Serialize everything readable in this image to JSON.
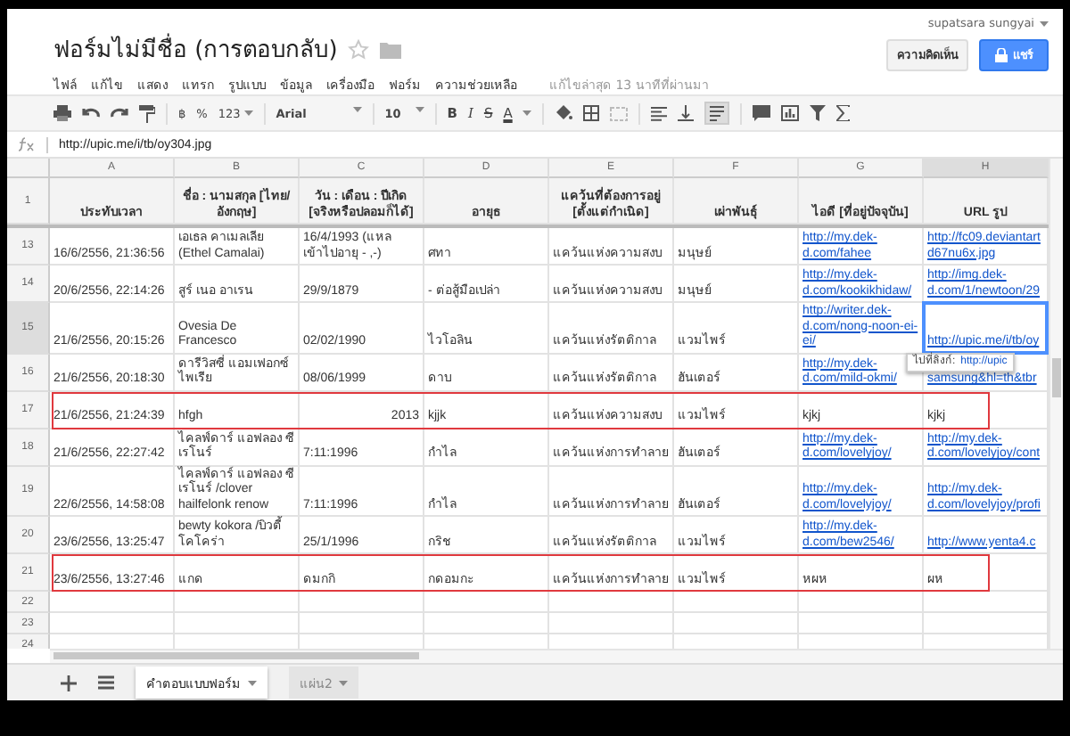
{
  "document": {
    "title": "ฟอร์มไม่มีชื่อ (การตอบกลับ)",
    "starred": false,
    "user": "supatsara sungyai",
    "comment_button": "ความคิดเห็น",
    "share_button": "แชร์",
    "last_edit": "แก้ไขล่าสุด 13 นาทีที่ผ่านมา"
  },
  "menu": [
    "ไฟล์",
    "แก้ไข",
    "แสดง",
    "แทรก",
    "รูปแบบ",
    "ข้อมูล",
    "เครื่องมือ",
    "ฟอร์ม",
    "ความช่วยเหลือ"
  ],
  "toolbar": {
    "currency": "฿",
    "percent": "%",
    "number_format": "123",
    "font": "Arial",
    "font_size": "10",
    "bold": "B",
    "italic": "I",
    "strikethrough": "S",
    "text_color": "A"
  },
  "formula_bar": {
    "value": "http://upic.me/i/tb/oy304.jpg"
  },
  "columns": [
    {
      "letter": "A",
      "selected": false
    },
    {
      "letter": "B",
      "selected": false
    },
    {
      "letter": "C",
      "selected": false
    },
    {
      "letter": "D",
      "selected": false
    },
    {
      "letter": "E",
      "selected": false
    },
    {
      "letter": "F",
      "selected": false
    },
    {
      "letter": "G",
      "selected": false
    },
    {
      "letter": "H",
      "selected": true
    }
  ],
  "header_row": {
    "number": "1",
    "cells": [
      "ประทับเวลา",
      "ชื่อ : นามสกุล [ไทย/อังกฤษ]",
      "วัน : เดือน : ปีเกิด [จริงหรือปลอมก็ได้]",
      "อายุธ",
      "แคว้นที่ต้องการอยู่ [ตั้งแต่กำเนิด]",
      "เผ่าพันธุ์",
      "ไอดี [ที่อยู่ปัจจุบัน]",
      "URL รูป"
    ]
  },
  "rows": [
    {
      "number": "13",
      "selected": false,
      "highlighted": false,
      "cells": [
        {
          "text": "16/6/2556, 21:36:56",
          "kind": "text"
        },
        {
          "text": "เอเธล คาเมลเลีย (Ethel Camalai)",
          "kind": "text"
        },
        {
          "text": "16/4/1993 (แหล เข้าไปอายุ - ,-)",
          "kind": "text"
        },
        {
          "text": "ศทา",
          "kind": "text"
        },
        {
          "text": "แคว้นแห่งความสงบ",
          "kind": "text"
        },
        {
          "text": "มนุษย์",
          "kind": "text"
        },
        {
          "text": "http://my.dek-d.com/fahee",
          "kind": "link"
        },
        {
          "text": "http://fc09.deviantart d67nu6x.jpg",
          "kind": "link"
        }
      ]
    },
    {
      "number": "14",
      "selected": false,
      "highlighted": false,
      "cells": [
        {
          "text": "20/6/2556, 22:14:26",
          "kind": "text"
        },
        {
          "text": "สูร์ เนอ อาเรน",
          "kind": "text"
        },
        {
          "text": "29/9/1879",
          "kind": "text"
        },
        {
          "text": "- ต่อสู้มือเปล่า",
          "kind": "text"
        },
        {
          "text": "แคว้นแห่งความสงบ",
          "kind": "text"
        },
        {
          "text": "มนุษย์",
          "kind": "text"
        },
        {
          "text": "http://my.dek-d.com/kookikhidaw/",
          "kind": "link"
        },
        {
          "text": "http://img.dek-d.com/1/newtoon/29",
          "kind": "link"
        }
      ]
    },
    {
      "number": "15",
      "selected": true,
      "highlighted": false,
      "cells": [
        {
          "text": "21/6/2556, 20:15:26",
          "kind": "text"
        },
        {
          "text": "Ovesia De Francesco",
          "kind": "text"
        },
        {
          "text": "02/02/1990",
          "kind": "text"
        },
        {
          "text": "ไวโอลิน",
          "kind": "text"
        },
        {
          "text": "แคว้นแห่งรัตติกาล",
          "kind": "text"
        },
        {
          "text": "แวมไพร์",
          "kind": "text"
        },
        {
          "text": "http://writer.dek-d.com/nong-noon-ei-ei/",
          "kind": "link"
        },
        {
          "text": "http://upic.me/i/tb/oy",
          "kind": "link"
        }
      ]
    },
    {
      "number": "16",
      "selected": false,
      "highlighted": false,
      "cells": [
        {
          "text": "21/6/2556, 20:18:30",
          "kind": "text"
        },
        {
          "text": "ดารีวิสซี่ แอมเฟอกซ์ ไพเรีย",
          "kind": "text"
        },
        {
          "text": "08/06/1999",
          "kind": "text"
        },
        {
          "text": "ดาบ",
          "kind": "text"
        },
        {
          "text": "แคว้นแห่งรัตติกาล",
          "kind": "text"
        },
        {
          "text": "ฮันเตอร์",
          "kind": "text"
        },
        {
          "text": "http://my.dek-d.com/mild-okmi/",
          "kind": "link"
        },
        {
          "text": "samsung&hl=th&tbr",
          "kind": "link"
        }
      ]
    },
    {
      "number": "17",
      "selected": false,
      "highlighted": true,
      "cells": [
        {
          "text": "21/6/2556, 21:24:39",
          "kind": "text"
        },
        {
          "text": "hfgh",
          "kind": "text"
        },
        {
          "text": "2013",
          "kind": "number"
        },
        {
          "text": "kjjk",
          "kind": "text"
        },
        {
          "text": "แคว้นแห่งความสงบ",
          "kind": "text"
        },
        {
          "text": "แวมไพร์",
          "kind": "text"
        },
        {
          "text": "kjkj",
          "kind": "text"
        },
        {
          "text": "kjkj",
          "kind": "text"
        }
      ]
    },
    {
      "number": "18",
      "selected": false,
      "highlighted": false,
      "cells": [
        {
          "text": "21/6/2556, 22:27:42",
          "kind": "text"
        },
        {
          "text": "ไคลฟ์ดาร์ แอฟลอง ซี เรโนร์",
          "kind": "text"
        },
        {
          "text": "7:11:1996",
          "kind": "text"
        },
        {
          "text": "กำไล",
          "kind": "text"
        },
        {
          "text": "แคว้นแห่งการทำลาย",
          "kind": "text"
        },
        {
          "text": "ฮันเตอร์",
          "kind": "text"
        },
        {
          "text": "http://my.dek-d.com/lovelyjoy/",
          "kind": "link"
        },
        {
          "text": "http://my.dek-d.com/lovelyjoy/cont",
          "kind": "link"
        }
      ]
    },
    {
      "number": "19",
      "selected": false,
      "highlighted": false,
      "cells": [
        {
          "text": "22/6/2556, 14:58:08",
          "kind": "text"
        },
        {
          "text": "ไคลฟ์ดาร์ แอฟลอง ซี เรโนร์ /clover hailfelonk renow",
          "kind": "text"
        },
        {
          "text": "7:11:1996",
          "kind": "text"
        },
        {
          "text": "กำไล",
          "kind": "text"
        },
        {
          "text": "แคว้นแห่งการทำลาย",
          "kind": "text"
        },
        {
          "text": "ฮันเตอร์",
          "kind": "text"
        },
        {
          "text": "http://my.dek-d.com/lovelyjoy/",
          "kind": "link"
        },
        {
          "text": "http://my.dek-d.com/lovelyjoy/profi",
          "kind": "link"
        }
      ]
    },
    {
      "number": "20",
      "selected": false,
      "highlighted": false,
      "cells": [
        {
          "text": "23/6/2556, 13:25:47",
          "kind": "text"
        },
        {
          "text": "bewty kokora /บิวตี้ โคโคร่า",
          "kind": "text"
        },
        {
          "text": "25/1/1996",
          "kind": "text"
        },
        {
          "text": "กริช",
          "kind": "text"
        },
        {
          "text": "แคว้นแห่งรัตติกาล",
          "kind": "text"
        },
        {
          "text": "แวมไพร์",
          "kind": "text"
        },
        {
          "text": "http://my.dek-d.com/bew2546/",
          "kind": "link"
        },
        {
          "text": "http://www.yenta4.c",
          "kind": "link"
        }
      ]
    },
    {
      "number": "21",
      "selected": false,
      "highlighted": true,
      "cells": [
        {
          "text": "23/6/2556, 13:27:46",
          "kind": "text"
        },
        {
          "text": "แกด",
          "kind": "text"
        },
        {
          "text": "ดมกกิ",
          "kind": "text"
        },
        {
          "text": "กดอมกะ",
          "kind": "text"
        },
        {
          "text": "แคว้นแห่งการทำลาย",
          "kind": "text"
        },
        {
          "text": "แวมไพร์",
          "kind": "text"
        },
        {
          "text": "หผห",
          "kind": "text"
        },
        {
          "text": "ผห",
          "kind": "text"
        }
      ]
    },
    {
      "number": "22",
      "selected": false,
      "highlighted": false,
      "cells": []
    },
    {
      "number": "23",
      "selected": false,
      "highlighted": false,
      "cells": []
    },
    {
      "number": "24",
      "selected": false,
      "highlighted": false,
      "cells": []
    }
  ],
  "tooltip": {
    "label": "ไปที่ลิงก์:",
    "link": "http://upic"
  },
  "sheet_tabs": [
    {
      "label": "คำตอบแบบฟอร์ม",
      "selected": true
    },
    {
      "label": "แผ่น2",
      "selected": false
    }
  ]
}
